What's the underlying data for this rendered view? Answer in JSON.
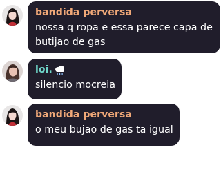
{
  "chat": {
    "messages": [
      {
        "sender": "bandida perversa",
        "sender_color": "#f0a878",
        "avatar": "woman-dark-hair-avatar",
        "lines": [
          "nossa q ropa e essa parece capa de",
          "butijao de gas"
        ]
      },
      {
        "sender": "loi.",
        "sender_color": "#6fd6c9",
        "sender_icon": "rain-cloud-icon",
        "avatar": "person-avatar",
        "lines": [
          "silencio mocreia"
        ]
      },
      {
        "sender": "bandida perversa",
        "sender_color": "#f0a878",
        "avatar": "woman-dark-hair-avatar",
        "lines": [
          "o meu bujao de gas ta igual"
        ]
      }
    ]
  },
  "colors": {
    "bubble_background": "#201d2b",
    "message_text": "#ffffff",
    "page_background": "#ffffff"
  }
}
